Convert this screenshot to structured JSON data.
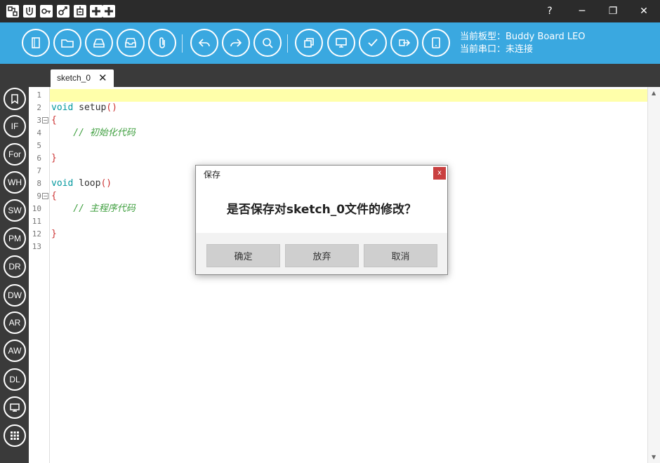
{
  "titlebar": {
    "logos": [
      "blocks-icon-1",
      "blocks-icon-2",
      "blocks-icon-3",
      "blocks-icon-4",
      "blocks-icon-5",
      "plus-icon",
      "plus-icon"
    ],
    "help_label": "?",
    "minimize_label": "─",
    "restore_label": "❐",
    "close_label": "✕"
  },
  "toolbar": {
    "board_label": "当前板型：Buddy Board LEO",
    "port_label": "当前串口：未连接"
  },
  "sidebar": {
    "items": [
      {
        "label": "",
        "icon": "bookmark-icon"
      },
      {
        "label": "IF"
      },
      {
        "label": "For"
      },
      {
        "label": "WH"
      },
      {
        "label": "SW"
      },
      {
        "label": "PM"
      },
      {
        "label": "DR"
      },
      {
        "label": "DW"
      },
      {
        "label": "AR"
      },
      {
        "label": "AW"
      },
      {
        "label": "DL"
      },
      {
        "label": "",
        "icon": "monitor-icon"
      },
      {
        "label": "",
        "icon": "grid-icon"
      }
    ]
  },
  "tab": {
    "label": "sketch_0",
    "close": "✕"
  },
  "editor": {
    "line_numbers": [
      "1",
      "2",
      "3",
      "4",
      "5",
      "6",
      "7",
      "8",
      "9",
      "10",
      "11",
      "12",
      "13"
    ],
    "lines": [
      "",
      "void setup()",
      "{",
      "    // 初始化代码",
      "",
      "}",
      "",
      "void loop()",
      "{",
      "    // 主程序代码",
      "",
      "}",
      ""
    ]
  },
  "dialog": {
    "title": "保存",
    "close": "x",
    "message": "是否保存对sketch_0文件的修改？",
    "buttons": {
      "confirm": "确定",
      "discard": "放弃",
      "cancel": "取消"
    }
  },
  "colors": {
    "toolbar_bg": "#3aa8e0",
    "chrome_bg": "#3a3a3a",
    "keyword": "#00979d",
    "comment": "#3f9f3f",
    "current_line": "#ffffaa"
  }
}
